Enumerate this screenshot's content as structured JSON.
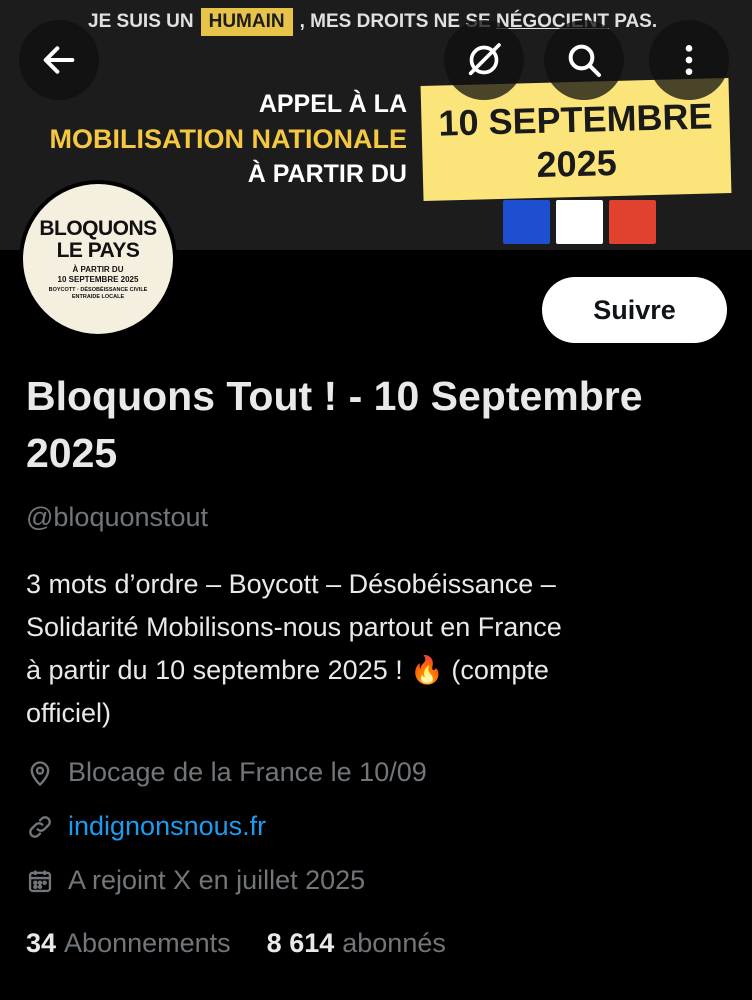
{
  "banner": {
    "top_before": "JE SUIS UN",
    "top_highlight": "HUMAIN",
    "top_mid": ", MES DROITS NE SE",
    "top_underlined": "NÉGOCIENT",
    "top_after": "PAS.",
    "appel_line1": "APPEL À LA",
    "appel_line2": "MOBILISATION NATIONALE",
    "appel_line3": "À PARTIR DU",
    "date_line1": "10 SEPTEMBRE",
    "date_line2": "2025",
    "flag_colors": [
      "#1f4fd1",
      "#ffffff",
      "#e0422f"
    ]
  },
  "header": {
    "back_icon": "arrow-left-icon",
    "grok_icon": "grok-icon",
    "search_icon": "search-icon",
    "more_icon": "more-vertical-icon"
  },
  "avatar": {
    "line1": "BLOQUONS",
    "line2": "LE PAYS",
    "line3": "À PARTIR DU",
    "line4": "10 SEPTEMBRE 2025",
    "line5": "BOYCOTT · DÉSOBÉISSANCE CIVILE",
    "line6": "ENTRAIDE LOCALE"
  },
  "profile": {
    "follow_label": "Suivre",
    "name": "Bloquons Tout ! - 10 Septembre 2025",
    "handle": "@bloquonstout",
    "bio_line1": "3 mots d’ordre – Boycott – Désobéissance –",
    "bio_line2": "Solidarité Mobilisons-nous partout en France",
    "bio_line3": "à partir du 10 septembre 2025 ! 🔥 (compte",
    "bio_line4": "officiel)",
    "location": "Blocage de la France le 10/09",
    "website": "indignonsnous.fr",
    "joined": "A rejoint X en juillet 2025",
    "following_count": "34",
    "following_label": "Abonnements",
    "followers_count": "8 614",
    "followers_label": "abonnés"
  },
  "colors": {
    "accent_link": "#1d9bf0",
    "muted_text": "#71767b",
    "banner_yellow": "#f5c842",
    "date_box": "#fbe479"
  }
}
